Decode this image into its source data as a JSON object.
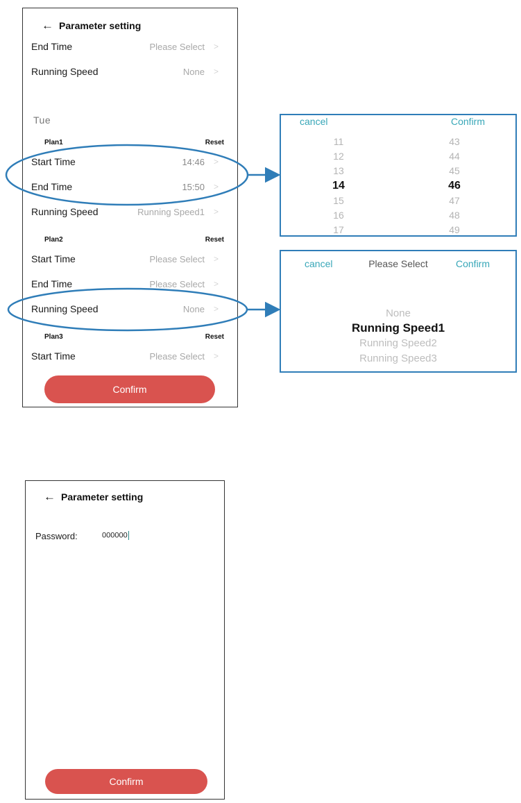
{
  "screen1": {
    "header": {
      "back_icon": "back-arrow-icon",
      "title": "Parameter setting"
    },
    "top_rows": [
      {
        "label": "End Time",
        "value": "Please Select"
      },
      {
        "label": "Running Speed",
        "value": "None"
      }
    ],
    "day": "Tue",
    "plans": [
      {
        "name": "Plan1",
        "reset": "Reset",
        "rows": [
          {
            "label": "Start Time",
            "value": "14:46"
          },
          {
            "label": "End Time",
            "value": "15:50"
          },
          {
            "label": "Running Speed",
            "value": "Running Speed1"
          }
        ]
      },
      {
        "name": "Plan2",
        "reset": "Reset",
        "rows": [
          {
            "label": "Start Time",
            "value": "Please Select"
          },
          {
            "label": "End Time",
            "value": "Please Select"
          },
          {
            "label": "Running Speed",
            "value": "None"
          }
        ]
      },
      {
        "name": "Plan3",
        "reset": "Reset",
        "rows": [
          {
            "label": "Start Time",
            "value": "Please Select"
          }
        ]
      }
    ],
    "confirm": "Confirm"
  },
  "time_picker": {
    "cancel": "cancel",
    "confirm": "Confirm",
    "hours": [
      "11",
      "12",
      "13",
      "14",
      "15",
      "16",
      "17"
    ],
    "minutes": [
      "43",
      "44",
      "45",
      "46",
      "47",
      "48",
      "49"
    ],
    "selected_hour": "14",
    "selected_minute": "46"
  },
  "speed_picker": {
    "cancel": "cancel",
    "title": "Please Select",
    "confirm": "Confirm",
    "options": [
      "None",
      "Running Speed1",
      "Running Speed2",
      "Running Speed3"
    ],
    "selected": "Running Speed1"
  },
  "screen2": {
    "header": {
      "back_icon": "back-arrow-icon",
      "title": "Parameter setting"
    },
    "password_label": "Password:",
    "password_value": "000000",
    "confirm": "Confirm"
  },
  "colors": {
    "confirm_button": "#d9534f",
    "picker_accent": "#38a7b8",
    "callout": "#2f7db8"
  }
}
